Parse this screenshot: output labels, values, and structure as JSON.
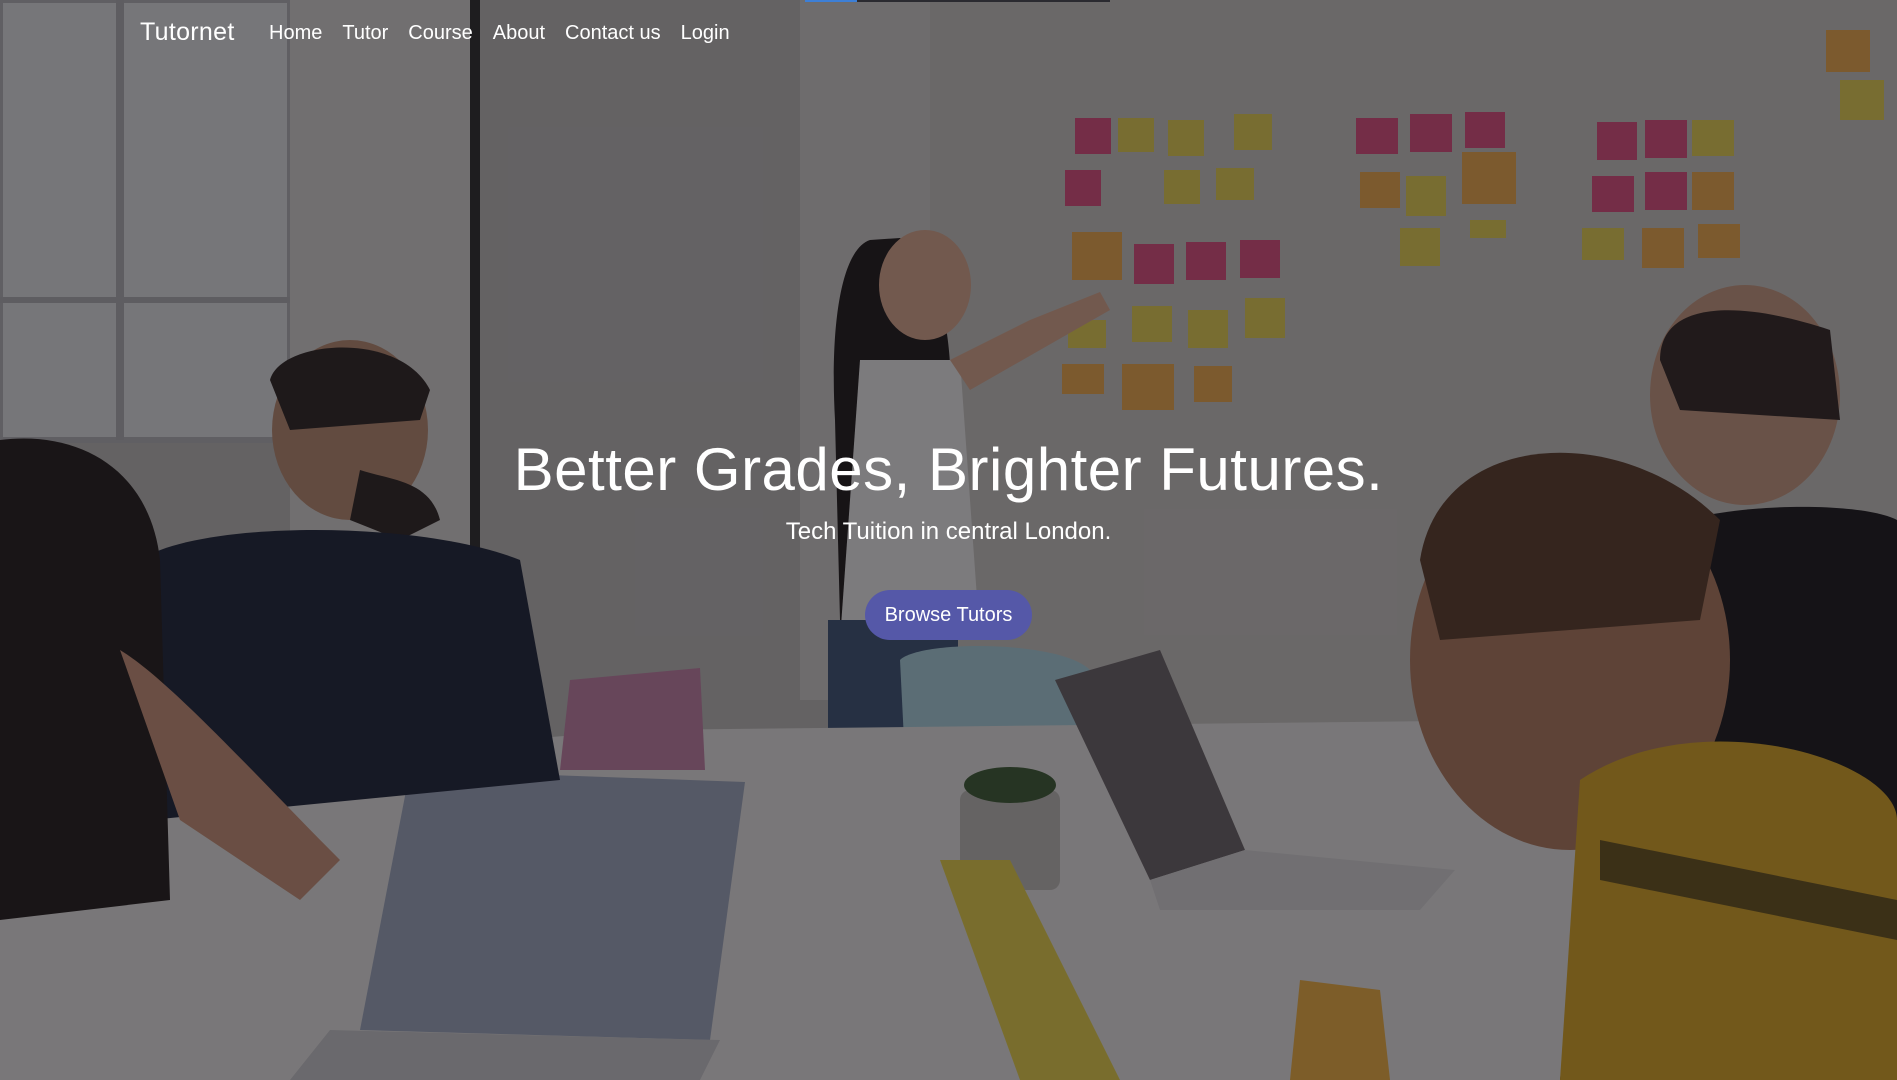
{
  "brand": {
    "name": "Tutornet"
  },
  "nav": {
    "items": [
      {
        "label": "Home"
      },
      {
        "label": "Tutor"
      },
      {
        "label": "Course"
      },
      {
        "label": "About"
      },
      {
        "label": "Contact us"
      },
      {
        "label": "Login"
      }
    ]
  },
  "hero": {
    "title": "Better Grades, Brighter Futures.",
    "subtitle": "Tech Tuition in central London.",
    "cta_label": "Browse Tutors",
    "background_image": "office-team-meeting-photo"
  },
  "loading": {
    "progress": 0.17
  },
  "colors": {
    "cta_background": "#5558a8",
    "text": "#ffffff",
    "overlay": "#1a181c",
    "progress_fill": "#3d7fd6"
  }
}
